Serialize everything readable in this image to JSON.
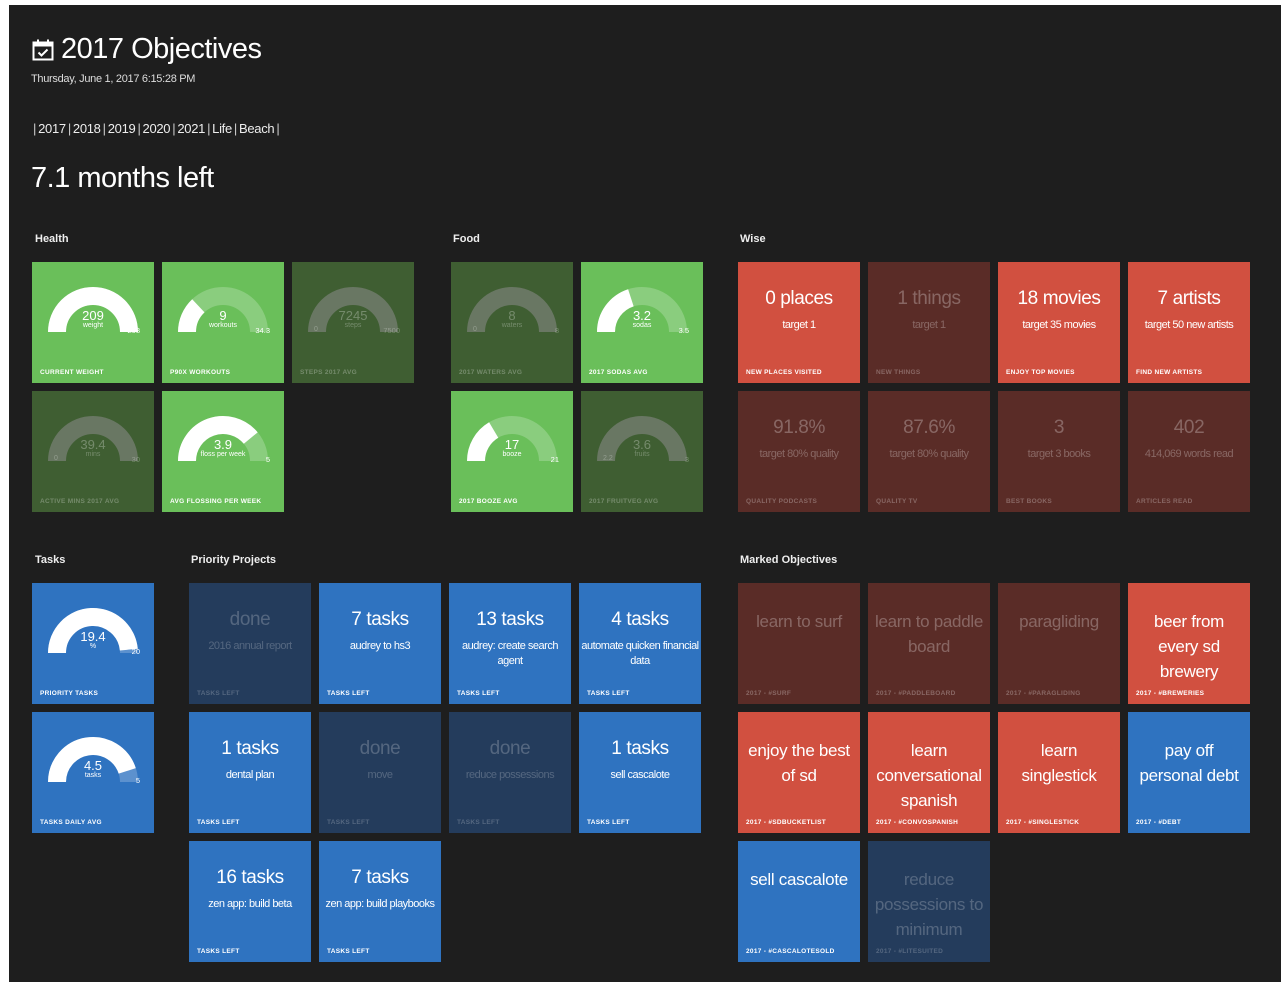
{
  "header": {
    "title": "2017 Objectives",
    "datetime": "Thursday, June 1, 2017 6:15:28 PM",
    "nav": [
      "2017",
      "2018",
      "2019",
      "2020",
      "2021",
      "Life",
      "Beach"
    ],
    "months_left": "7.1 months left"
  },
  "sections": {
    "health": "Health",
    "food": "Food",
    "wise": "Wise",
    "tasks": "Tasks",
    "priority": "Priority Projects",
    "marked": "Marked Objectives"
  },
  "gauges": [
    {
      "id": "current-weight",
      "value": "209",
      "unit": "weight",
      "min": "165",
      "max": "208",
      "fraction": 1.0,
      "footer": "CURRENT WEIGHT",
      "active": true
    },
    {
      "id": "p90x-workouts",
      "value": "9",
      "unit": "workouts",
      "min": "0",
      "max": "34.3",
      "fraction": 0.26,
      "footer": "P90X WORKOUTS",
      "active": true
    },
    {
      "id": "steps-avg",
      "value": "7245",
      "unit": "steps",
      "min": "0",
      "max": "7500",
      "fraction": 0.97,
      "footer": "STEPS 2017 AVG",
      "active": false
    },
    {
      "id": "active-mins",
      "value": "39.4",
      "unit": "mins",
      "min": "0",
      "max": "30",
      "fraction": 1.0,
      "footer": "ACTIVE MINS 2017 AVG",
      "active": false
    },
    {
      "id": "flossing",
      "value": "3.9",
      "unit": "floss per week",
      "min": "0",
      "max": "5",
      "fraction": 0.78,
      "footer": "AVG FLOSSING PER WEEK",
      "active": true
    },
    {
      "id": "waters-avg",
      "value": "8",
      "unit": "waters",
      "min": "0",
      "max": "8",
      "fraction": 1.0,
      "footer": "2017 WATERS AVG",
      "active": false
    },
    {
      "id": "sodas-avg",
      "value": "3.2",
      "unit": "sodas",
      "min": "3",
      "max": "3.5",
      "fraction": 0.4,
      "footer": "2017 SODAS AVG",
      "active": true
    },
    {
      "id": "booze-avg",
      "value": "17",
      "unit": "booze",
      "min": "15",
      "max": "21",
      "fraction": 0.33,
      "footer": "2017 BOOZE AVG",
      "active": true
    },
    {
      "id": "fruits-avg",
      "value": "3.6",
      "unit": "fruits",
      "min": "2.2",
      "max": "3",
      "fraction": 1.0,
      "footer": "2017 FRUITVEG AVG",
      "active": false
    },
    {
      "id": "priority-tasks",
      "value": "19.4",
      "unit": "%",
      "min": "0",
      "max": "20",
      "fraction": 0.97,
      "footer": "PRIORITY TASKS",
      "active": true
    },
    {
      "id": "tasks-daily",
      "value": "4.5",
      "unit": "tasks",
      "min": "0",
      "max": "5",
      "fraction": 0.9,
      "footer": "TASKS DAILY AVG",
      "active": true
    }
  ],
  "wise": [
    {
      "big": "0 places",
      "sub": "target 1",
      "footer": "NEW PLACES VISITED",
      "active": true
    },
    {
      "big": "1 things",
      "sub": "target 1",
      "footer": "NEW THINGS",
      "active": false
    },
    {
      "big": "18 movies",
      "sub": "target 35 movies",
      "footer": "ENJOY TOP MOVIES",
      "active": true
    },
    {
      "big": "7 artists",
      "sub": "target 50 new artists",
      "footer": "FIND NEW ARTISTS",
      "active": true
    },
    {
      "big": "91.8%",
      "sub": "target 80% quality",
      "footer": "QUALITY PODCASTS",
      "active": false
    },
    {
      "big": "87.6%",
      "sub": "target 80% quality",
      "footer": "QUALITY TV",
      "active": false
    },
    {
      "big": "3",
      "sub": "target 3 books",
      "footer": "BEST BOOKS",
      "active": false
    },
    {
      "big": "402",
      "sub": "414,069 words read",
      "footer": "ARTICLES READ",
      "active": false
    }
  ],
  "projects": [
    {
      "big": "done",
      "sub": "2016 annual report",
      "footer": "TASKS LEFT",
      "active": false
    },
    {
      "big": "7 tasks",
      "sub": "audrey to hs3",
      "footer": "TASKS LEFT",
      "active": true
    },
    {
      "big": "13 tasks",
      "sub": "audrey: create search agent",
      "footer": "TASKS LEFT",
      "active": true
    },
    {
      "big": "4 tasks",
      "sub": "automate quicken financial data",
      "footer": "TASKS LEFT",
      "active": true
    },
    {
      "big": "1 tasks",
      "sub": "dental plan",
      "footer": "TASKS LEFT",
      "active": true
    },
    {
      "big": "done",
      "sub": "move",
      "footer": "TASKS LEFT",
      "active": false
    },
    {
      "big": "done",
      "sub": "reduce possessions",
      "footer": "TASKS LEFT",
      "active": false
    },
    {
      "big": "1 tasks",
      "sub": "sell cascalote",
      "footer": "TASKS LEFT",
      "active": true
    },
    {
      "big": "16 tasks",
      "sub": "zen app: build beta",
      "footer": "TASKS LEFT",
      "active": true
    },
    {
      "big": "7 tasks",
      "sub": "zen app: build playbooks",
      "footer": "TASKS LEFT",
      "active": true
    }
  ],
  "marked": [
    {
      "text": "learn to surf",
      "footer": "2017 - #SURF",
      "color": "red",
      "active": false
    },
    {
      "text": "learn to paddle board",
      "footer": "2017 - #PADDLEBOARD",
      "color": "red",
      "active": false
    },
    {
      "text": "paragliding",
      "footer": "2017 - #PARAGLIDING",
      "color": "red",
      "active": false
    },
    {
      "text": "beer from every sd brewery",
      "footer": "2017 - #BREWERIES",
      "color": "red",
      "active": true
    },
    {
      "text": "enjoy the best of sd",
      "footer": "2017 - #SDBUCKETLIST",
      "color": "red",
      "active": true
    },
    {
      "text": "learn conversational spanish",
      "footer": "2017 - #CONVOSPANISH",
      "color": "red",
      "active": true
    },
    {
      "text": "learn singlestick",
      "footer": "2017 - #SINGLESTICK",
      "color": "red",
      "active": true
    },
    {
      "text": "pay off personal debt",
      "footer": "2017 - #DEBT",
      "color": "blue",
      "active": true
    },
    {
      "text": "sell cascalote",
      "footer": "2017 - #CASCALOTESOLD",
      "color": "blue",
      "active": true
    },
    {
      "text": "reduce possessions to minimum",
      "footer": "2017 - #LITESUITED",
      "color": "blue",
      "active": false
    }
  ]
}
